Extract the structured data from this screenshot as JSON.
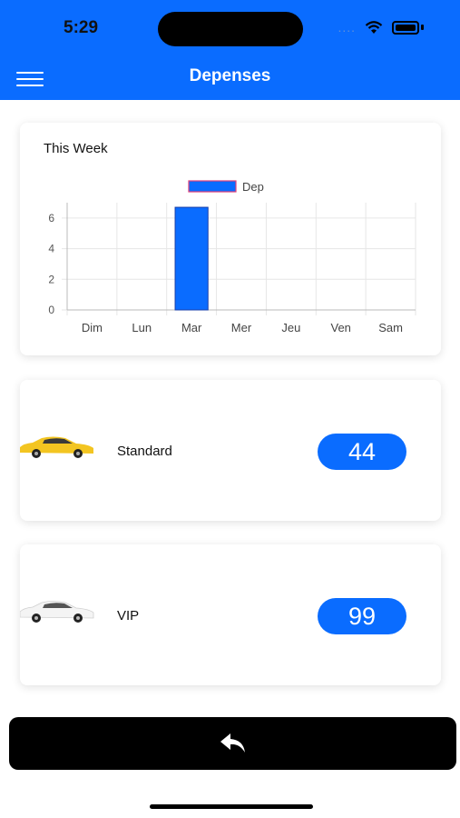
{
  "status": {
    "time": "5:29"
  },
  "header": {
    "title": "Depenses",
    "menu_icon": "hamburger-menu-icon",
    "bg_color": "#0a6cff"
  },
  "chart_card": {
    "title": "This Week"
  },
  "chart_data": {
    "type": "bar",
    "categories": [
      "Dim",
      "Lun",
      "Mar",
      "Mer",
      "Jeu",
      "Ven",
      "Sam"
    ],
    "series": [
      {
        "name": "Dep",
        "values": [
          0,
          0,
          6.7,
          0,
          0,
          0,
          0
        ]
      }
    ],
    "yticks": [
      "0",
      "2",
      "4",
      "6"
    ],
    "ylim": [
      0,
      7
    ],
    "grid": true,
    "legend": "top-center",
    "bar_color": "#0a6cff"
  },
  "rows": [
    {
      "label": "Standard",
      "value": "44",
      "icon": "yellow-taxi-car-icon"
    },
    {
      "label": "VIP",
      "value": "99",
      "icon": "white-sedan-car-icon"
    }
  ],
  "footer": {
    "back_icon": "reply-arrow-icon"
  }
}
